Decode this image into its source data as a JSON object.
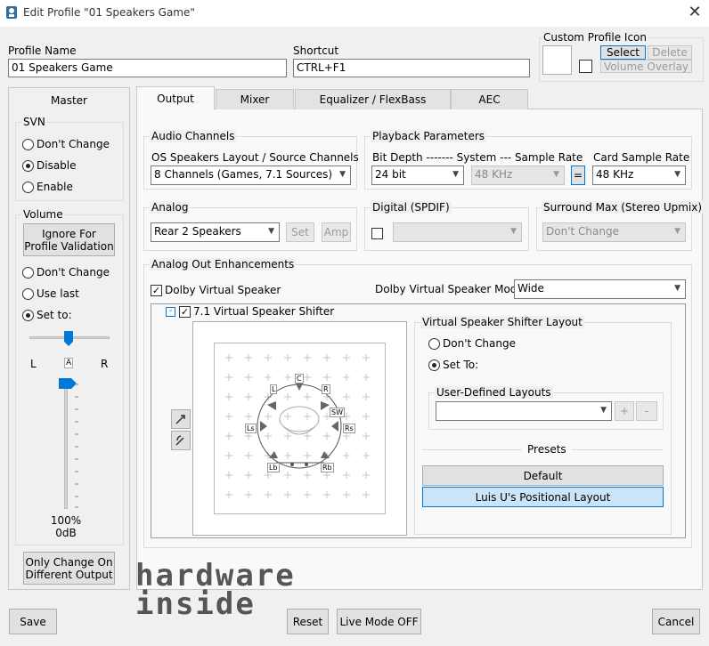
{
  "window": {
    "title": "Edit Profile \"01 Speakers Game\""
  },
  "profile_name": {
    "label": "Profile Name",
    "value": "01 Speakers Game"
  },
  "shortcut": {
    "label": "Shortcut",
    "value": "CTRL+F1"
  },
  "custom_icon": {
    "label": "Custom Profile Icon",
    "select": "Select",
    "delete": "Delete",
    "volume_overlay": "Volume Overlay"
  },
  "master": {
    "title": "Master",
    "svn": {
      "label": "SVN",
      "options": [
        "Don't Change",
        "Disable",
        "Enable"
      ],
      "selected": "Disable"
    },
    "volume": {
      "label": "Volume",
      "ignore_button": "Ignore For Profile Validation",
      "options": [
        "Don't Change",
        "Use last",
        "Set to:"
      ],
      "selected": "Set to:",
      "balance_left": "L",
      "balance_center": "A",
      "balance_right": "R",
      "percent": "100%",
      "db": "0dB"
    },
    "only_change_button": "Only Change On Different Output"
  },
  "tabs": [
    "Output",
    "Mixer",
    "Equalizer / FlexBass",
    "AEC"
  ],
  "active_tab": "Output",
  "audio_channels": {
    "title": "Audio Channels",
    "sublabel": "OS Speakers Layout / Source Channels",
    "value": "8 Channels (Games, 7.1 Sources)"
  },
  "playback": {
    "title": "Playback Parameters",
    "header": "Bit Depth ------- System --- Sample Rate",
    "bit_depth": "24 bit",
    "system_rate": "48 KHz",
    "equals": "=",
    "card_label": "Card Sample Rate",
    "card_rate": "48 KHz"
  },
  "analog": {
    "title": "Analog",
    "value": "Rear 2 Speakers",
    "set": "Set",
    "amp": "Amp"
  },
  "digital": {
    "title": "Digital (SPDIF)",
    "value": ""
  },
  "surround": {
    "title": "Surround Max (Stereo Upmix)",
    "value": "Don't Change"
  },
  "enhancements": {
    "title": "Analog Out Enhancements",
    "dolby_label": "Dolby Virtual Speaker",
    "dolby_checked": true,
    "mode_label": "Dolby Virtual Speaker Mode:",
    "mode_value": "Wide",
    "shifter_label": "7.1 Virtual Speaker Shifter",
    "shifter_checked": true,
    "collapse": "-",
    "speakers": [
      "C",
      "L",
      "R",
      "SW",
      "Ls",
      "Rs",
      "Lb",
      "Rb"
    ]
  },
  "shifter_layout": {
    "title": "Virtual Speaker Shifter Layout",
    "options": [
      "Don't Change",
      "Set To:"
    ],
    "selected": "Set To:",
    "user_defined_label": "User-Defined Layouts",
    "user_defined_value": "",
    "add": "+",
    "remove": "-",
    "presets_label": "Presets",
    "presets": [
      "Default",
      "Luis U's Positional Layout"
    ],
    "selected_preset": "Luis U's Positional Layout"
  },
  "watermark": {
    "line1": "hardware",
    "line2": "inside"
  },
  "footer": {
    "save": "Save",
    "reset": "Reset",
    "live_mode": "Live Mode OFF",
    "cancel": "Cancel"
  }
}
